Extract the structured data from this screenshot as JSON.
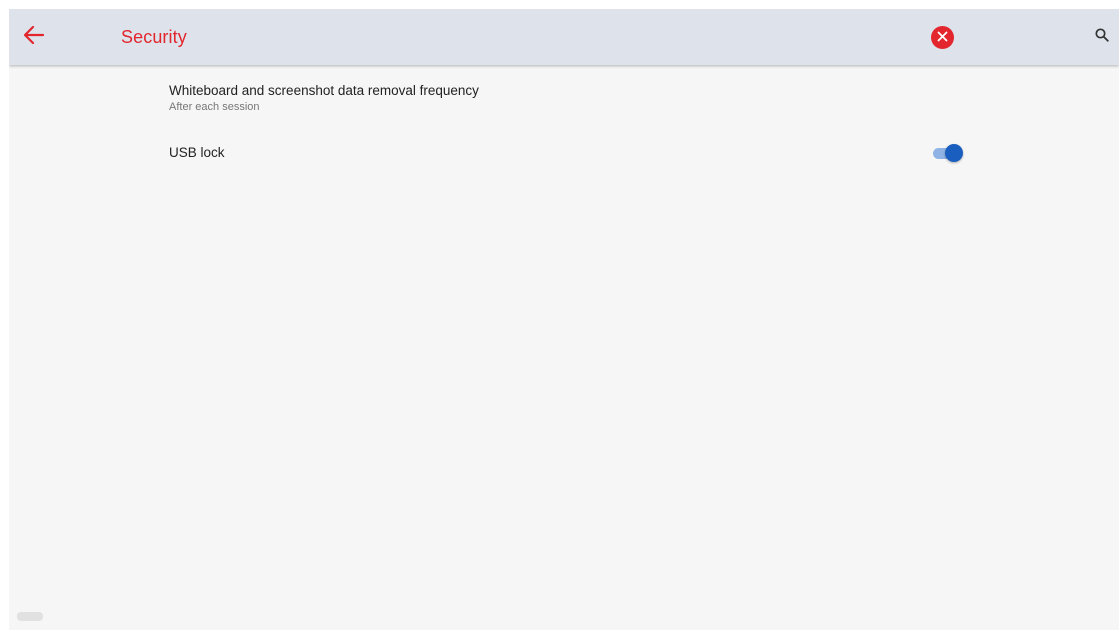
{
  "header": {
    "title": "Security",
    "back_icon": "arrow-left-icon",
    "close_icon": "close-circle-icon",
    "search_icon": "search-icon"
  },
  "settings": {
    "items": [
      {
        "title": "Whiteboard and screenshot data removal frequency",
        "summary": "After each session"
      },
      {
        "title": "USB lock",
        "toggle_state": "on"
      }
    ]
  },
  "colors": {
    "accent": "#e3262e",
    "app_bar": "#dde2eb",
    "background": "#f6f6f6",
    "toggle_on": "#1a5fbf",
    "toggle_track": "#8fb3e4"
  }
}
